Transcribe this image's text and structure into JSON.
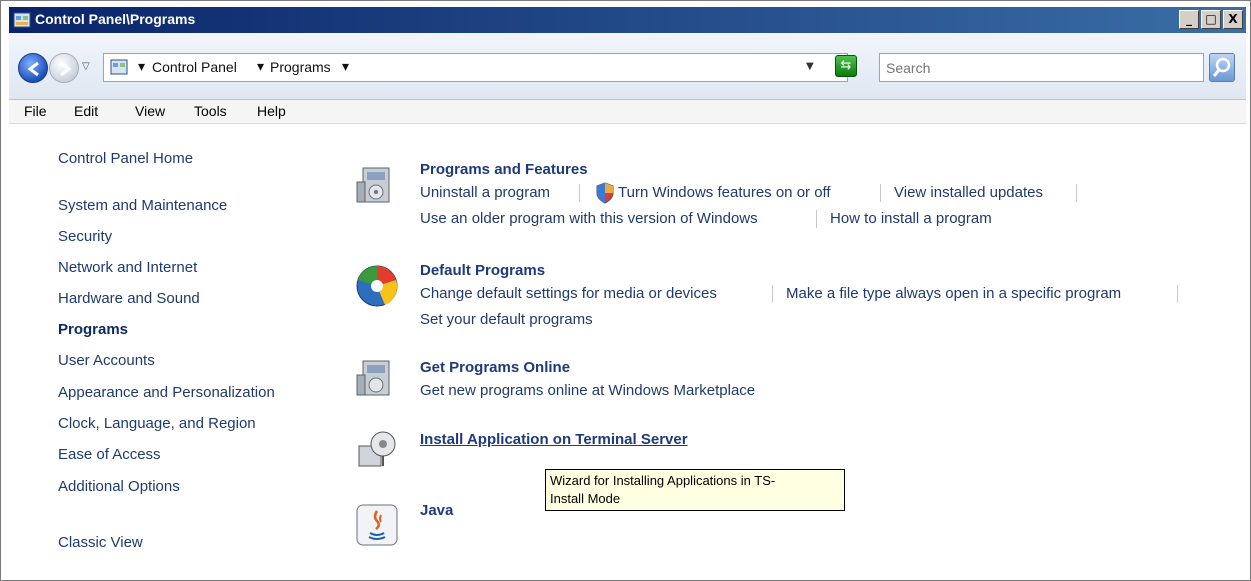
{
  "window": {
    "title": "Control Panel\\Programs",
    "controls": [
      "_",
      "□",
      "X"
    ]
  },
  "address": {
    "breadcrumb": [
      "Control Panel",
      "Programs"
    ],
    "search_placeholder": "Search"
  },
  "menu": [
    "File",
    "Edit",
    "View",
    "Tools",
    "Help"
  ],
  "sidebar": {
    "items": [
      {
        "label": "Control Panel Home"
      },
      {
        "label": "System and Maintenance"
      },
      {
        "label": "Security"
      },
      {
        "label": "Network and Internet"
      },
      {
        "label": "Hardware and Sound"
      },
      {
        "label": "Programs",
        "active": true
      },
      {
        "label": "User Accounts"
      },
      {
        "label": "Appearance and Personalization"
      },
      {
        "label": "Clock, Language, and Region"
      },
      {
        "label": "Ease of Access"
      },
      {
        "label": "Additional Options"
      },
      {
        "label": "Classic View"
      }
    ]
  },
  "categories": [
    {
      "title": "Programs and Features",
      "icon": "programs-features-icon",
      "links": [
        "Uninstall a program",
        "Turn Windows features on or off",
        "View installed updates",
        "Use an older program with this version of Windows",
        "How to install a program"
      ]
    },
    {
      "title": "Default Programs",
      "icon": "default-programs-icon",
      "links": [
        "Change default settings for media or devices",
        "Make a file type always open in a specific program",
        "Set your default programs"
      ]
    },
    {
      "title": "Get Programs Online",
      "icon": "get-programs-online-icon",
      "links": [
        "Get new programs online at Windows Marketplace"
      ]
    },
    {
      "title": "Install Application on Terminal Server",
      "icon": "terminal-server-icon",
      "links": []
    },
    {
      "title": "Java",
      "icon": "java-icon",
      "links": []
    }
  ],
  "tooltip": {
    "line1": "Wizard for Installing Applications in TS-",
    "line2": "Install Mode"
  },
  "colors": {
    "link": "#1f3a6d",
    "title_bar": "#0a246a",
    "tooltip_bg": "#ffffe1"
  }
}
